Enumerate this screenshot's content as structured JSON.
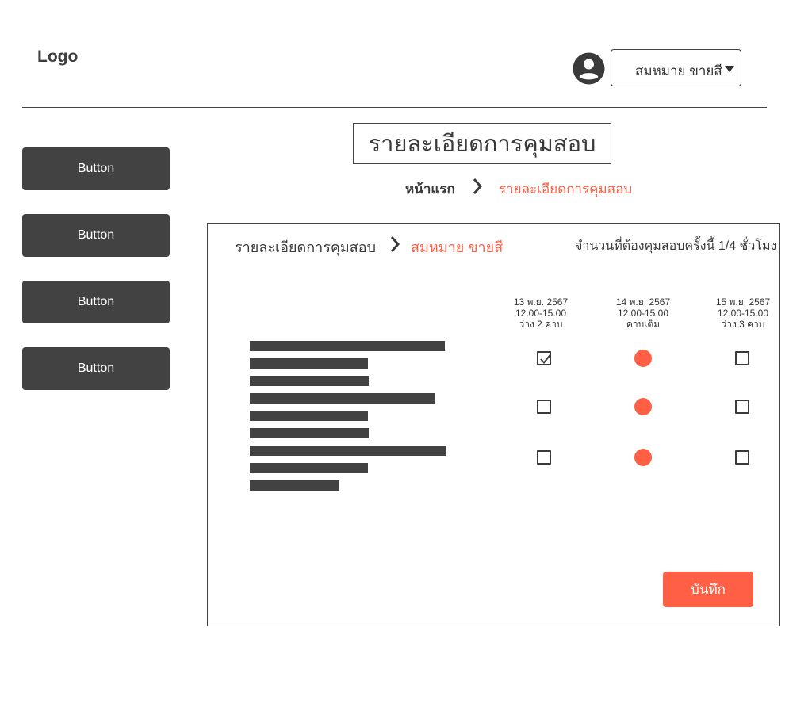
{
  "header": {
    "logo": "Logo",
    "avatar_icon": "account-circle-icon",
    "user_name": "สมหมาย ขายสี",
    "dropdown_icon": "caret-down-icon"
  },
  "sidebar": {
    "buttons": [
      {
        "label": "Button"
      },
      {
        "label": "Button"
      },
      {
        "label": "Button"
      },
      {
        "label": "Button"
      }
    ]
  },
  "page": {
    "title": "รายละเอียดการคุมสอบ",
    "breadcrumb": {
      "home": "หน้าแรก",
      "current": "รายละเอียดการคุมสอบ",
      "separator_icon": "chevron-right-icon"
    }
  },
  "panel": {
    "breadcrumb": {
      "section": "รายละเอียดการคุมสอบ",
      "person": "สมหมาย ขายสี"
    },
    "hours_text": "จำนวนที่ต้องคุมสอบครั้งนี้ 1/4 ชั่วโมง",
    "columns": [
      {
        "date": "13 พ.ย. 2567",
        "time": "12.00-15.00",
        "status": "ว่าง 2 คาบ"
      },
      {
        "date": "14 พ.ย. 2567",
        "time": "12.00-15.00",
        "status": "คาบเต็ม"
      },
      {
        "date": "15 พ.ย. 2567",
        "time": "12.00-15.00",
        "status": "ว่าง 3 คาบ"
      }
    ],
    "rows": [
      {
        "cells": [
          "checked",
          "full",
          "unchecked"
        ]
      },
      {
        "cells": [
          "unchecked",
          "full",
          "unchecked"
        ]
      },
      {
        "cells": [
          "unchecked",
          "full",
          "unchecked"
        ]
      }
    ],
    "save_label": "บันทึก"
  },
  "colors": {
    "accent": "#ff5f45",
    "dark": "#424242"
  }
}
